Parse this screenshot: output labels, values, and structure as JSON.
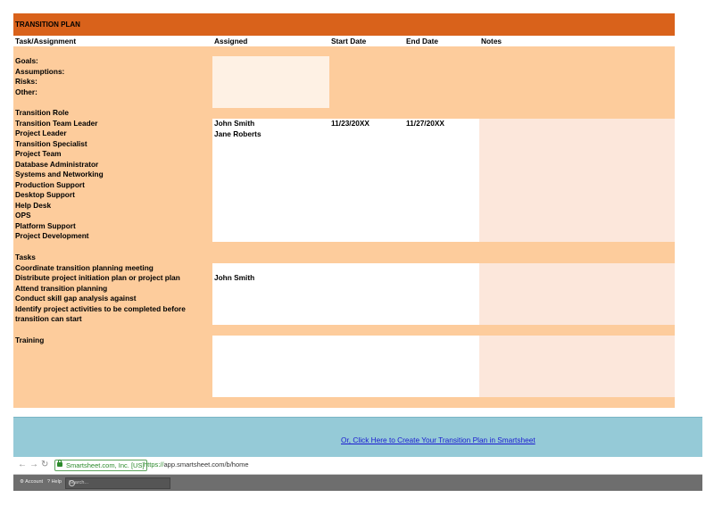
{
  "document": {
    "title": "TRANSITION PLAN",
    "headers": {
      "task": "Task/Assignment",
      "assigned": "Assigned",
      "start": "Start Date",
      "end": "End Date",
      "notes": "Notes"
    },
    "overview": [
      "Goals:",
      "Assumptions:",
      "Risks:",
      "Other:"
    ],
    "roles": {
      "heading": "Transition Role",
      "items": [
        "Transition Team Leader",
        "Project Leader",
        "Transition Specialist",
        "Project Team",
        "Database Administrator",
        "Systems and Networking",
        "Production Support",
        "Desktop Support",
        "Help Desk",
        "OPS",
        "Platform Support",
        "Project Development"
      ],
      "assigned": [
        "John Smith",
        "Jane Roberts"
      ],
      "start_date": "11/23/20XX",
      "end_date": "11/27/20XX"
    },
    "tasks": {
      "heading": "Tasks",
      "items": [
        "Coordinate transition planning meeting",
        "Distribute project initiation plan or project plan",
        "Attend transition planning",
        "Conduct skill gap analysis against",
        "Identify project activities to be completed before",
        "transition can start"
      ],
      "assigned": "John Smith"
    },
    "training": {
      "heading": "Training"
    }
  },
  "promo": {
    "link": "Or, Click Here to Create Your Transition Plan in Smartsheet"
  },
  "browser": {
    "back": "←",
    "forward": "→",
    "reload": "↻",
    "secure_label": "Smartsheet.com, Inc. [US]",
    "url_scheme": "https://",
    "url_rest": "app.smartsheet.com/b/home"
  },
  "appbar": {
    "account": "⚙ Account",
    "help": "? Help",
    "search_placeholder": "Search..."
  }
}
